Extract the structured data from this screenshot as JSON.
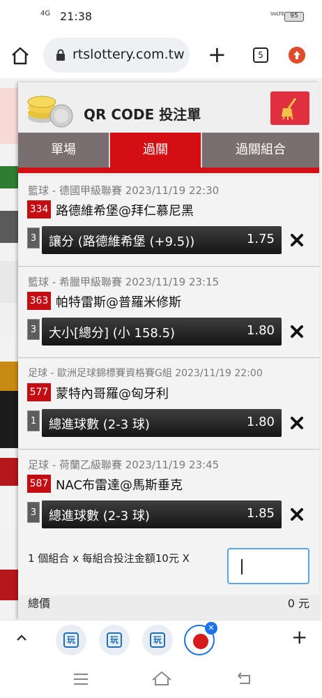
{
  "status_bar": {
    "network": "4G",
    "time": "21:38",
    "volte": "VoLTE",
    "battery": "95"
  },
  "browser": {
    "url": "rtslottery.com.tw",
    "tab_count": "5"
  },
  "panel": {
    "title": "QR CODE 投注單",
    "tabs": [
      {
        "label": "單場",
        "active": false
      },
      {
        "label": "過關",
        "active": true
      },
      {
        "label": "過關組合",
        "active": false
      }
    ],
    "bets": [
      {
        "league": "籃球 - 德國甲級聯賽 2023/11/19 22:30",
        "code": "334",
        "match": "路德維希堡@拜仁慕尼黑",
        "num": "3",
        "option": "讓分 (路德維希堡 (+9.5))",
        "odds": "1.75"
      },
      {
        "league": "籃球 - 希臘甲級聯賽 2023/11/19 23:15",
        "code": "363",
        "match": "帕特雷斯@普羅米修斯",
        "num": "3",
        "option": "大小[總分] (小 158.5)",
        "odds": "1.80"
      },
      {
        "league": "足球 - 歐洲足球錦標賽資格賽G組 2023/11/19 22:00",
        "code": "577",
        "match": "蒙特內哥羅@匈牙利",
        "num": "1",
        "option": "總進球數 (2-3 球)",
        "odds": "1.80"
      },
      {
        "league": "足球 - 荷蘭乙級聯賽 2023/11/19 23:45",
        "code": "587",
        "match": "NAC布雷達@馬斯垂克",
        "num": "3",
        "option": "總進球數 (2-3 球)",
        "odds": "1.85"
      }
    ],
    "combo_text": "1 個組合 x 每組合投注金額10元 X",
    "amount_value": "",
    "total_label": "總價",
    "total_value": "0 元"
  },
  "colors": {
    "brand_red": "#d40f14",
    "tab_inactive": "#7a6f70",
    "broom_button": "#e02f3f",
    "input_focus": "#5aa4e8",
    "link_blue": "#1a73e8"
  },
  "icons": [
    "home-icon",
    "lock-icon",
    "plus-icon",
    "tabs-icon",
    "update-icon",
    "coins-icon",
    "broom-icon",
    "remove-icon",
    "chevron-up-icon",
    "back-icon",
    "recents-icon"
  ]
}
